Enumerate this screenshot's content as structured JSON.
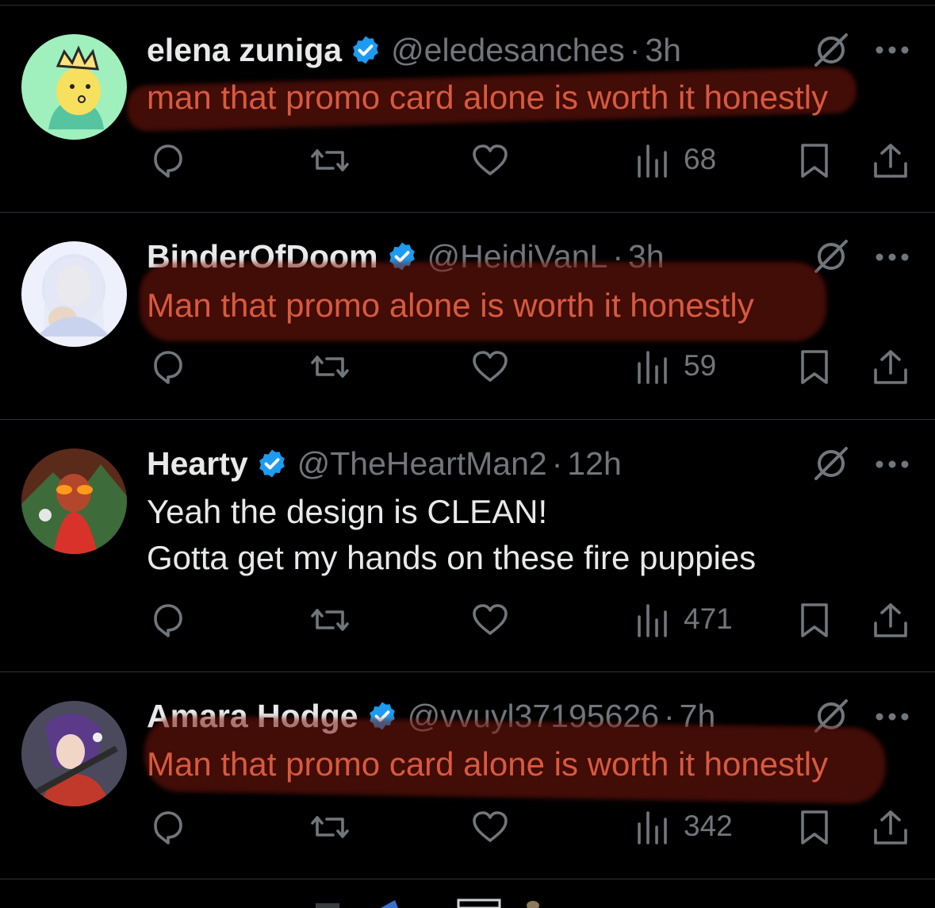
{
  "colors": {
    "background": "#000000",
    "text_primary": "#e7e9ea",
    "text_secondary": "#71767b",
    "verified_blue": "#1d9bf0",
    "highlight_text": "#d85a3e"
  },
  "icons": {
    "verified": "verified-badge-icon",
    "grok": "grok-icon",
    "more": "more-icon",
    "reply": "reply-icon",
    "repost": "repost-icon",
    "like": "like-icon",
    "views": "views-icon",
    "bookmark": "bookmark-icon",
    "share": "share-icon"
  },
  "tweets": [
    {
      "name": "elena zuniga",
      "handle": "@eledesanches",
      "separator": "·",
      "time": "3h",
      "lines": [
        "man that promo card alone is worth it honestly"
      ],
      "views": "68"
    },
    {
      "name": "BinderOfDoom",
      "handle": "@HeidiVanL",
      "separator": "·",
      "time": "3h",
      "lines": [
        "Man that promo alone is worth it honestly"
      ],
      "views": "59"
    },
    {
      "name": "Hearty",
      "handle": "@TheHeartMan2",
      "separator": "·",
      "time": "12h",
      "lines": [
        "Yeah the design is CLEAN!",
        "Gotta get my hands on these fire puppies"
      ],
      "views": "471"
    },
    {
      "name": "Amara Hodge",
      "handle": "@vvuyl37195626",
      "separator": "·",
      "time": "7h",
      "lines": [
        "Man that promo card alone is worth it honestly"
      ],
      "views": "342"
    }
  ]
}
